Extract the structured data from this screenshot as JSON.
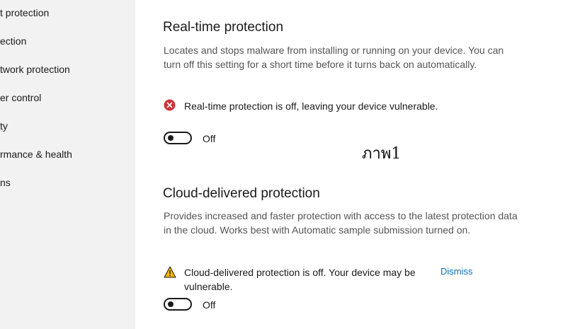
{
  "sidebar": {
    "items": [
      {
        "label": "t protection"
      },
      {
        "label": "ection"
      },
      {
        "label": "twork protection"
      },
      {
        "label": "er control"
      },
      {
        "label": "ty"
      },
      {
        "label": "rmance & health"
      },
      {
        "label": "ns"
      }
    ]
  },
  "realtime": {
    "title": "Real-time protection",
    "description": "Locates and stops malware from installing or running on your device. You can turn off this setting for a short time before it turns back on automatically.",
    "status_text": "Real-time protection is off, leaving your device vulnerable.",
    "status_icon": "error-icon",
    "toggle_label": "Off"
  },
  "overlay": {
    "text": "ภาพ1"
  },
  "cloud": {
    "title": "Cloud-delivered protection",
    "description": "Provides increased and faster protection with access to the latest protection data in the cloud. Works best with Automatic sample submission turned on.",
    "status_text_line1": "Cloud-delivered protection is off. Your device may be",
    "status_text_line2": "vulnerable.",
    "status_icon": "warning-icon",
    "dismiss_label": "Dismiss",
    "toggle_label": "Off"
  },
  "colors": {
    "error": "#d13438",
    "warning": "#f0b400",
    "link": "#0a6fb5",
    "sidebar_bg": "#f2f2f2"
  }
}
